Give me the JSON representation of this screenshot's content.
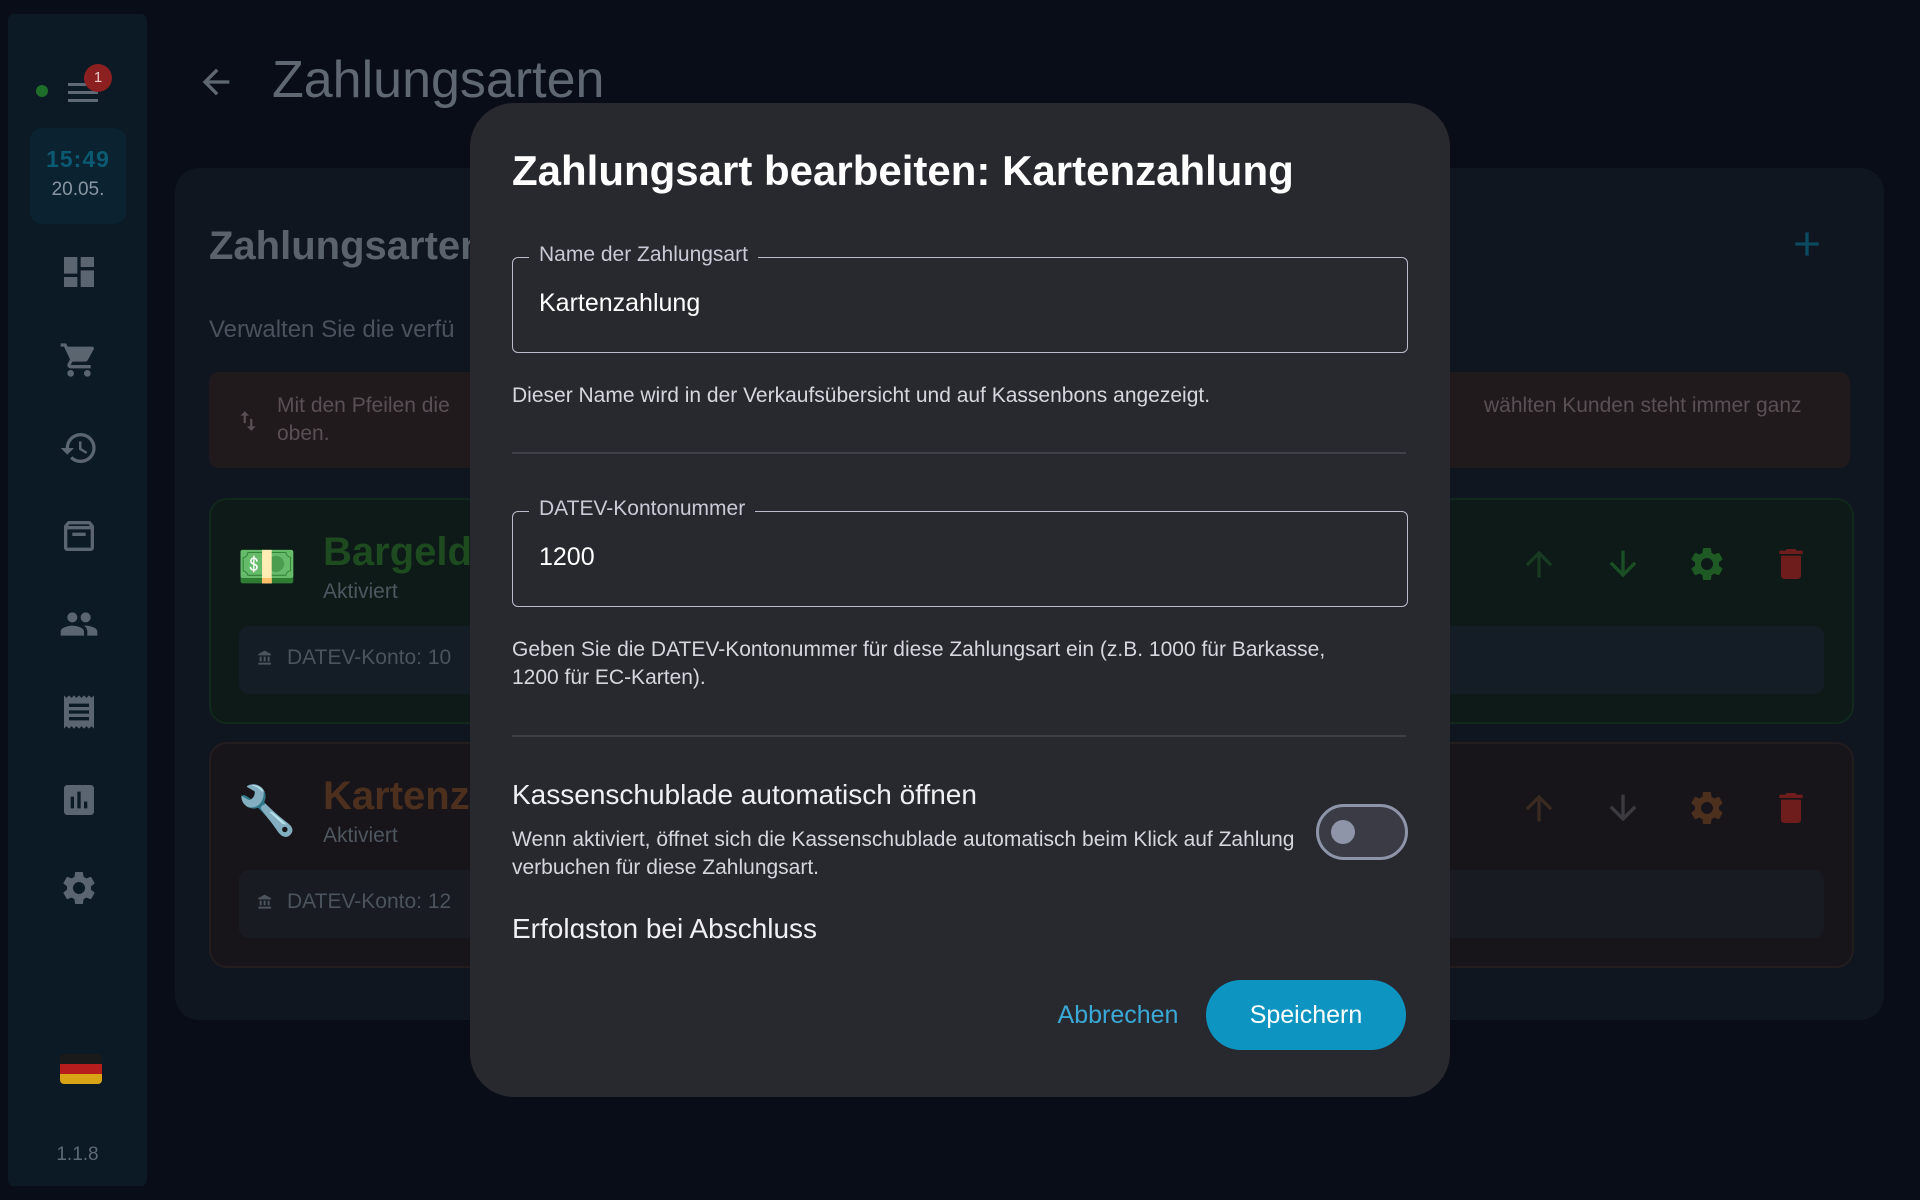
{
  "sidebar": {
    "badge_count": "1",
    "time": "15:49",
    "date": "20.05.",
    "version": "1.1.8",
    "nav_icons": [
      "dashboard-icon",
      "cart-icon",
      "history-icon",
      "archive-icon",
      "people-icon",
      "receipt-icon",
      "chart-icon",
      "gear-icon"
    ]
  },
  "header": {
    "title": "Zahlungsarten"
  },
  "card": {
    "title": "Zahlungsarten",
    "subtitle": "Verwalten Sie die verfü",
    "info_left": "Mit den Pfeilen die oben.",
    "info_right": "wählten Kunden steht immer ganz",
    "methods": [
      {
        "emoji": "💵",
        "name": "Bargeld",
        "status": "Aktiviert",
        "account": "DATEV-Konto: 10",
        "color": "#1d4a1f"
      },
      {
        "emoji": "🔧",
        "name": "Kartenza",
        "status": "Aktiviert",
        "account": "DATEV-Konto: 12",
        "color": "#4d2f1e"
      }
    ]
  },
  "dialog": {
    "title": "Zahlungsart bearbeiten: Kartenzahlung",
    "name_field": {
      "label": "Name der Zahlungsart",
      "value": "Kartenzahlung",
      "help": "Dieser Name wird in der Verkaufsübersicht und auf Kassenbons angezeigt."
    },
    "datev_field": {
      "label": "DATEV-Kontonummer",
      "value": "1200",
      "help": "Geben Sie die DATEV-Kontonummer für diese Zahlungsart ein (z.B. 1000 für Barkasse, 1200 für EC-Karten)."
    },
    "drawer_toggle": {
      "label": "Kassenschublade automatisch öffnen",
      "help": "Wenn aktiviert, öffnet sich die Kassenschublade automatisch beim Klick auf Zahlung verbuchen für diese Zahlungsart.",
      "enabled": false
    },
    "next_section_cut": "Erfolgston bei Abschluss",
    "cancel_label": "Abbrechen",
    "save_label": "Speichern",
    "accent": "#0e94c0"
  }
}
